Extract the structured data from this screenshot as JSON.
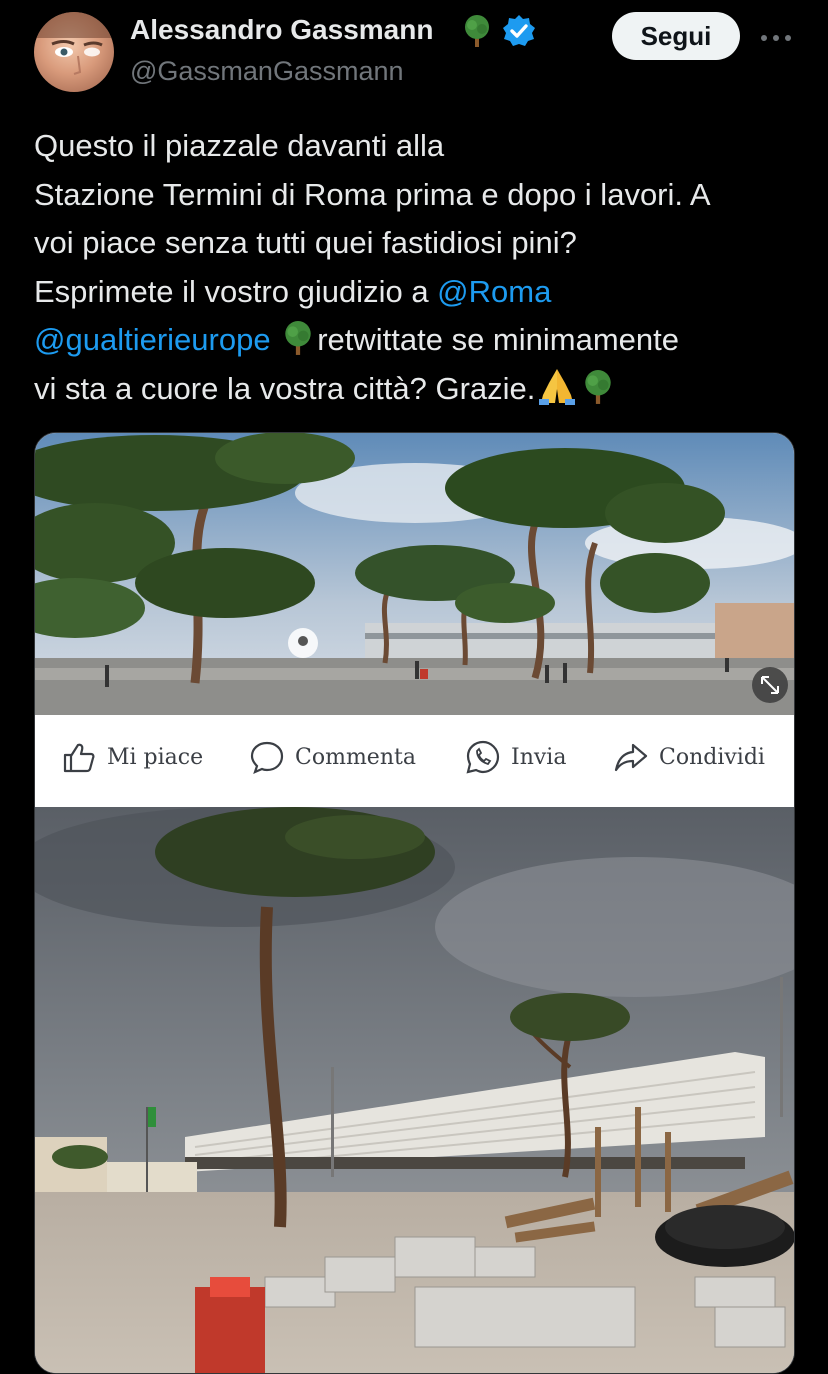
{
  "author": {
    "display_name": "Alessandro Gassmann",
    "handle": "@GassmanGassmann"
  },
  "actions": {
    "follow_label": "Segui"
  },
  "tweet": {
    "line1": "Questo il piazzale davanti alla",
    "line2": "Stazione Termini di Roma prima e dopo i lavori. A",
    "line3": "voi piace senza tutti quei fastidiosi pini?",
    "line4_text": "Esprimete il vostro giudizio a ",
    "mention_roma": "@Roma",
    "mention_gualtieri": "@gualtierieurope",
    "line5_text": "retwittate se minimamente",
    "line6_text": "vi sta a cuore la vostra città? Grazie."
  },
  "embedded_post_bar": {
    "like_label": "Mi piace",
    "comment_label": "Commenta",
    "send_label": "Invia",
    "share_label": "Condividi"
  },
  "colors": {
    "background": "#000000",
    "text": "#e7e9ea",
    "secondary_text": "#71767b",
    "mention": "#1d9bf0",
    "verified": "#1d9bf0",
    "follow_button_bg": "#eff3f4"
  },
  "icons": [
    "tree-emoji-icon",
    "verified-badge-icon",
    "more-options-icon",
    "praying-hands-icon",
    "like-icon",
    "comment-icon",
    "whatsapp-icon",
    "share-icon",
    "expand-icon",
    "location-pin-icon"
  ]
}
